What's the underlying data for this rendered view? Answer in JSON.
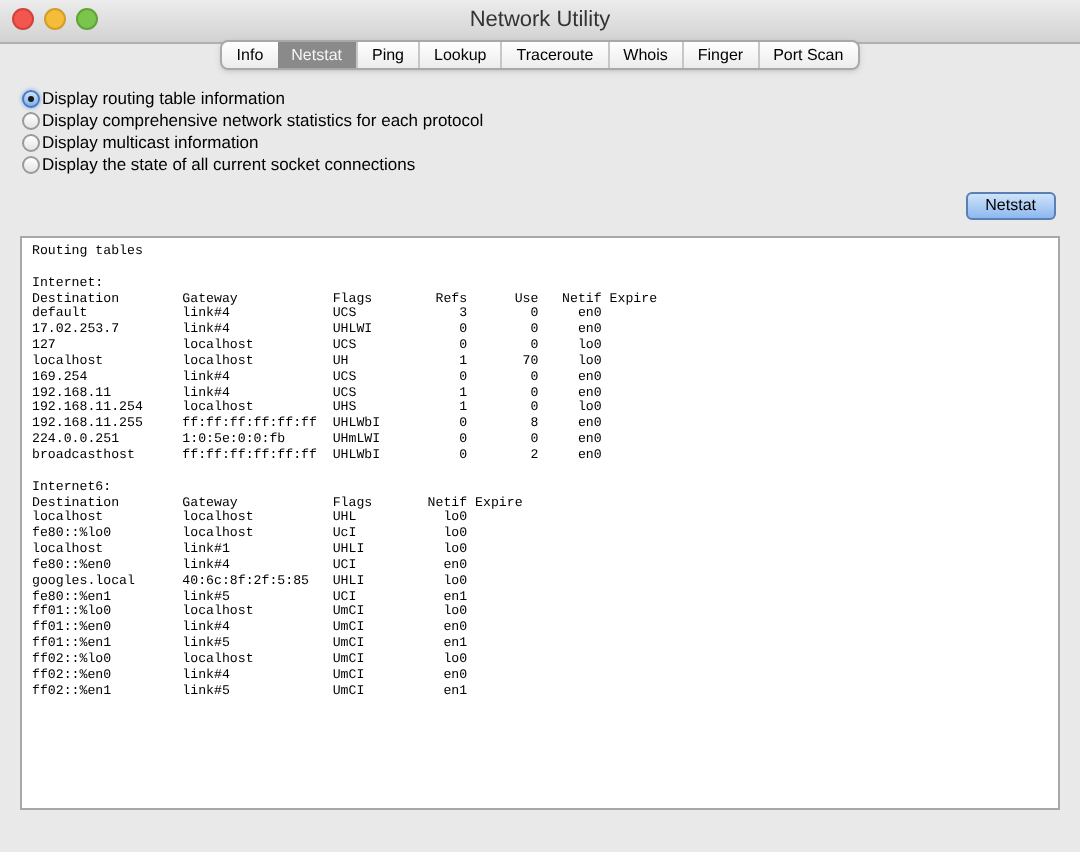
{
  "window": {
    "title": "Network Utility"
  },
  "tabs": [
    {
      "label": "Info",
      "selected": false
    },
    {
      "label": "Netstat",
      "selected": true
    },
    {
      "label": "Ping",
      "selected": false
    },
    {
      "label": "Lookup",
      "selected": false
    },
    {
      "label": "Traceroute",
      "selected": false
    },
    {
      "label": "Whois",
      "selected": false
    },
    {
      "label": "Finger",
      "selected": false
    },
    {
      "label": "Port Scan",
      "selected": false
    }
  ],
  "options": [
    {
      "label": "Display routing table information",
      "selected": true
    },
    {
      "label": "Display comprehensive network statistics for each protocol",
      "selected": false
    },
    {
      "label": "Display multicast information",
      "selected": false
    },
    {
      "label": "Display the state of all current socket connections",
      "selected": false
    }
  ],
  "action_button": "Netstat",
  "output": {
    "title": "Routing tables",
    "sections": [
      {
        "heading": "Internet:",
        "columns": [
          {
            "label": "Destination",
            "numeric": false
          },
          {
            "label": "Gateway",
            "numeric": false
          },
          {
            "label": "Flags",
            "numeric": false
          },
          {
            "label": "Refs",
            "numeric": true
          },
          {
            "label": "Use",
            "numeric": true
          },
          {
            "label": "Netif",
            "numeric": true
          },
          {
            "label": "Expire",
            "numeric": false
          }
        ],
        "rows": [
          [
            "default",
            "link#4",
            "UCS",
            "3",
            "0",
            "en0"
          ],
          [
            "17.02.253.7",
            "link#4",
            "UHLWI",
            "0",
            "0",
            "en0"
          ],
          [
            "127",
            "localhost",
            "UCS",
            "0",
            "0",
            "lo0"
          ],
          [
            "localhost",
            "localhost",
            "UH",
            "1",
            "70",
            "lo0"
          ],
          [
            "169.254",
            "link#4",
            "UCS",
            "0",
            "0",
            "en0"
          ],
          [
            "192.168.11",
            "link#4",
            "UCS",
            "1",
            "0",
            "en0"
          ],
          [
            "192.168.11.254",
            "localhost",
            "UHS",
            "1",
            "0",
            "lo0"
          ],
          [
            "192.168.11.255",
            "ff:ff:ff:ff:ff:ff",
            "UHLWbI",
            "0",
            "8",
            "en0"
          ],
          [
            "224.0.0.251",
            "1:0:5e:0:0:fb",
            "UHmLWI",
            "0",
            "0",
            "en0"
          ],
          [
            "broadcasthost",
            "ff:ff:ff:ff:ff:ff",
            "UHLWbI",
            "0",
            "2",
            "en0"
          ]
        ]
      },
      {
        "heading": "Internet6:",
        "columns": [
          {
            "label": "Destination",
            "numeric": false
          },
          {
            "label": "Gateway",
            "numeric": false
          },
          {
            "label": "Flags",
            "numeric": false
          },
          {
            "label": "Netif",
            "numeric": true
          },
          {
            "label": "Expire",
            "numeric": false
          }
        ],
        "rows": [
          [
            "localhost",
            "localhost",
            "UHL",
            "lo0"
          ],
          [
            "fe80::%lo0",
            "localhost",
            "UcI",
            "lo0"
          ],
          [
            "localhost",
            "link#1",
            "UHLI",
            "lo0"
          ],
          [
            "fe80::%en0",
            "link#4",
            "UCI",
            "en0"
          ],
          [
            "googles.local",
            "40:6c:8f:2f:5:85",
            "UHLI",
            "lo0"
          ],
          [
            "fe80::%en1",
            "link#5",
            "UCI",
            "en1"
          ],
          [
            "ff01::%lo0",
            "localhost",
            "UmCI",
            "lo0"
          ],
          [
            "ff01::%en0",
            "link#4",
            "UmCI",
            "en0"
          ],
          [
            "ff01::%en1",
            "link#5",
            "UmCI",
            "en1"
          ],
          [
            "ff02::%lo0",
            "localhost",
            "UmCI",
            "lo0"
          ],
          [
            "ff02::%en0",
            "link#4",
            "UmCI",
            "en0"
          ],
          [
            "ff02::%en1",
            "link#5",
            "UmCI",
            "en1"
          ]
        ]
      }
    ]
  }
}
